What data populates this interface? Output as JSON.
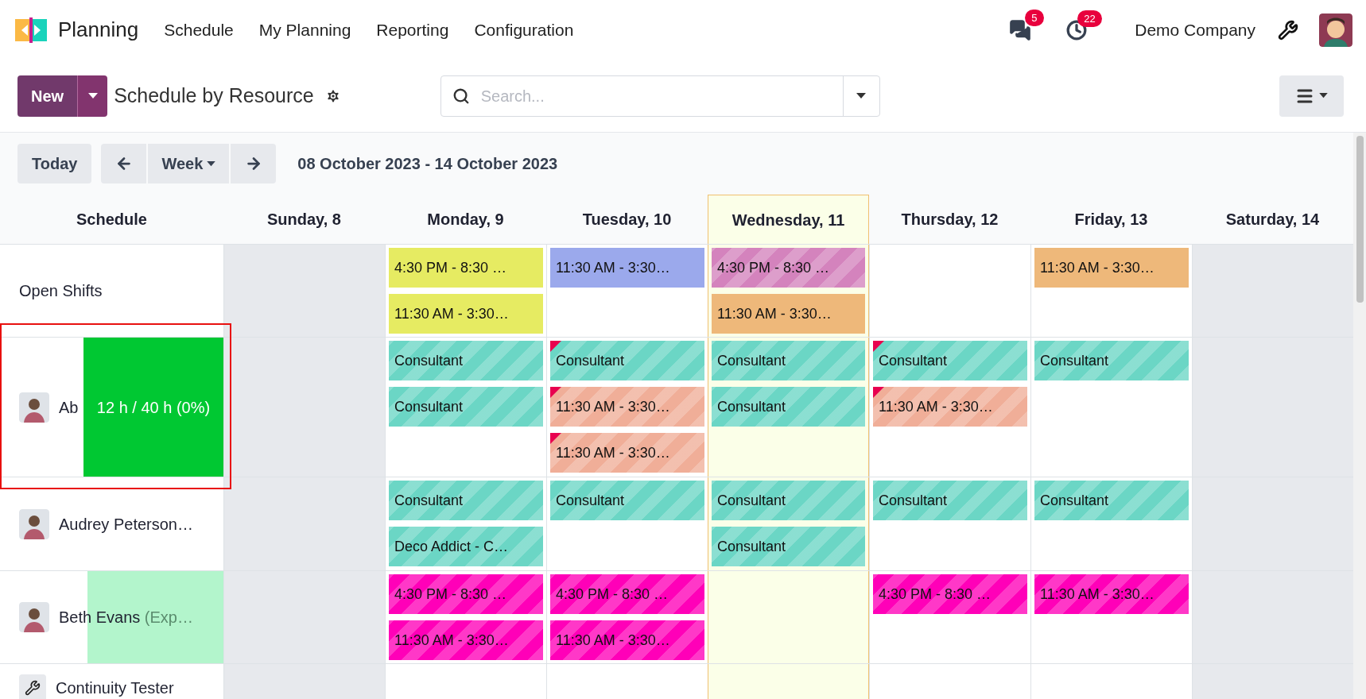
{
  "app": {
    "name": "Planning",
    "menu": [
      "Schedule",
      "My Planning",
      "Reporting",
      "Configuration"
    ],
    "messages_badge": "5",
    "activities_badge": "22",
    "company": "Demo Company"
  },
  "control_bar": {
    "new_label": "New",
    "view_title": "Schedule by Resource",
    "search": {
      "placeholder": "Search..."
    }
  },
  "gantt": {
    "today_label": "Today",
    "scale_label": "Week",
    "range": "08 October 2023 - 14 October 2023",
    "row_header": "Schedule",
    "days": [
      {
        "label": "Sunday, 8",
        "today": false,
        "off": true
      },
      {
        "label": "Monday, 9",
        "today": false,
        "off": false
      },
      {
        "label": "Tuesday, 10",
        "today": false,
        "off": false
      },
      {
        "label": "Wednesday, 11",
        "today": true,
        "off": false
      },
      {
        "label": "Thursday, 12",
        "today": false,
        "off": false
      },
      {
        "label": "Friday, 13",
        "today": false,
        "off": false
      },
      {
        "label": "Saturday, 14",
        "today": false,
        "off": true
      }
    ],
    "rows": [
      {
        "name": "Open Shifts",
        "framed": false,
        "cells": [
          [],
          [
            {
              "text": "4:30 PM - 8:30 …",
              "color": "#e6eb62",
              "striped": false,
              "flagged": false
            },
            {
              "text": "11:30 AM - 3:30…",
              "color": "#e6eb62",
              "striped": false,
              "flagged": false
            }
          ],
          [
            {
              "text": "11:30 AM - 3:30…",
              "color": "#9ba9ec",
              "striped": false,
              "flagged": false
            }
          ],
          [
            {
              "text": "4:30 PM - 8:30 …",
              "color": "#d483bd",
              "striped": true,
              "flagged": false
            },
            {
              "text": "11:30 AM - 3:30…",
              "color": "#eeb87a",
              "striped": false,
              "flagged": false
            }
          ],
          [],
          [
            {
              "text": "11:30 AM - 3:30…",
              "color": "#eeb87a",
              "striped": false,
              "flagged": false
            }
          ],
          []
        ]
      },
      {
        "name": "Ab",
        "avatar": {
          "kind": "photo"
        },
        "framed": true,
        "workload": {
          "kind": "hover",
          "text": "12 h / 40 h (0%)"
        },
        "cells": [
          [],
          [
            {
              "text": "Consultant",
              "color": "#6bd6c5",
              "striped": true,
              "flagged": false
            },
            {
              "text": "Consultant",
              "color": "#6bd6c5",
              "striped": true,
              "flagged": false
            }
          ],
          [
            {
              "text": "Consultant",
              "color": "#6bd6c5",
              "striped": true,
              "flagged": true
            },
            {
              "text": "11:30 AM - 3:30…",
              "color": "#f0ae98",
              "striped": true,
              "flagged": true
            },
            {
              "text": "11:30 AM - 3:30…",
              "color": "#f0ae98",
              "striped": true,
              "flagged": true
            }
          ],
          [
            {
              "text": "Consultant",
              "color": "#6bd6c5",
              "striped": true,
              "flagged": false
            },
            {
              "text": "Consultant",
              "color": "#6bd6c5",
              "striped": true,
              "flagged": false
            }
          ],
          [
            {
              "text": "Consultant",
              "color": "#6bd6c5",
              "striped": true,
              "flagged": true
            },
            {
              "text": "11:30 AM - 3:30…",
              "color": "#f0ae98",
              "striped": true,
              "flagged": true
            }
          ],
          [
            {
              "text": "Consultant",
              "color": "#6bd6c5",
              "striped": true,
              "flagged": false
            }
          ],
          []
        ]
      },
      {
        "name": "Audrey Peterson…",
        "avatar": {
          "kind": "photo"
        },
        "framed": false,
        "cells": [
          [],
          [
            {
              "text": "Consultant",
              "color": "#6bd6c5",
              "striped": true,
              "flagged": false
            },
            {
              "text": "Deco Addict - C…",
              "color": "#6bd6c5",
              "striped": true,
              "flagged": false
            }
          ],
          [
            {
              "text": "Consultant",
              "color": "#6bd6c5",
              "striped": true,
              "flagged": false
            }
          ],
          [
            {
              "text": "Consultant",
              "color": "#6bd6c5",
              "striped": true,
              "flagged": false
            },
            {
              "text": "Consultant",
              "color": "#6bd6c5",
              "striped": true,
              "flagged": false
            }
          ],
          [
            {
              "text": "Consultant",
              "color": "#6bd6c5",
              "striped": true,
              "flagged": false
            }
          ],
          [
            {
              "text": "Consultant",
              "color": "#6bd6c5",
              "striped": true,
              "flagged": false
            }
          ],
          []
        ]
      },
      {
        "name": "Beth Evans",
        "note": "(Exp…",
        "avatar": {
          "kind": "photo"
        },
        "framed": false,
        "workload": {
          "kind": "bar"
        },
        "cells": [
          [],
          [
            {
              "text": "4:30 PM - 8:30 …",
              "color": "#ff00b8",
              "striped": true,
              "flagged": false
            },
            {
              "text": "11:30 AM - 3:30…",
              "color": "#ff00b8",
              "striped": true,
              "flagged": false
            }
          ],
          [
            {
              "text": "4:30 PM - 8:30 …",
              "color": "#ff00b8",
              "striped": true,
              "flagged": false
            },
            {
              "text": "11:30 AM - 3:30…",
              "color": "#ff00b8",
              "striped": true,
              "flagged": false
            }
          ],
          [],
          [
            {
              "text": "4:30 PM - 8:30 …",
              "color": "#ff00b8",
              "striped": true,
              "flagged": false
            }
          ],
          [
            {
              "text": "11:30 AM - 3:30…",
              "color": "#ff00b8",
              "striped": true,
              "flagged": false
            }
          ],
          []
        ]
      },
      {
        "name": "Continuity Tester",
        "avatar": {
          "kind": "tool"
        },
        "framed": false,
        "cells": [
          [],
          [],
          [],
          [],
          [],
          [],
          []
        ]
      }
    ]
  }
}
